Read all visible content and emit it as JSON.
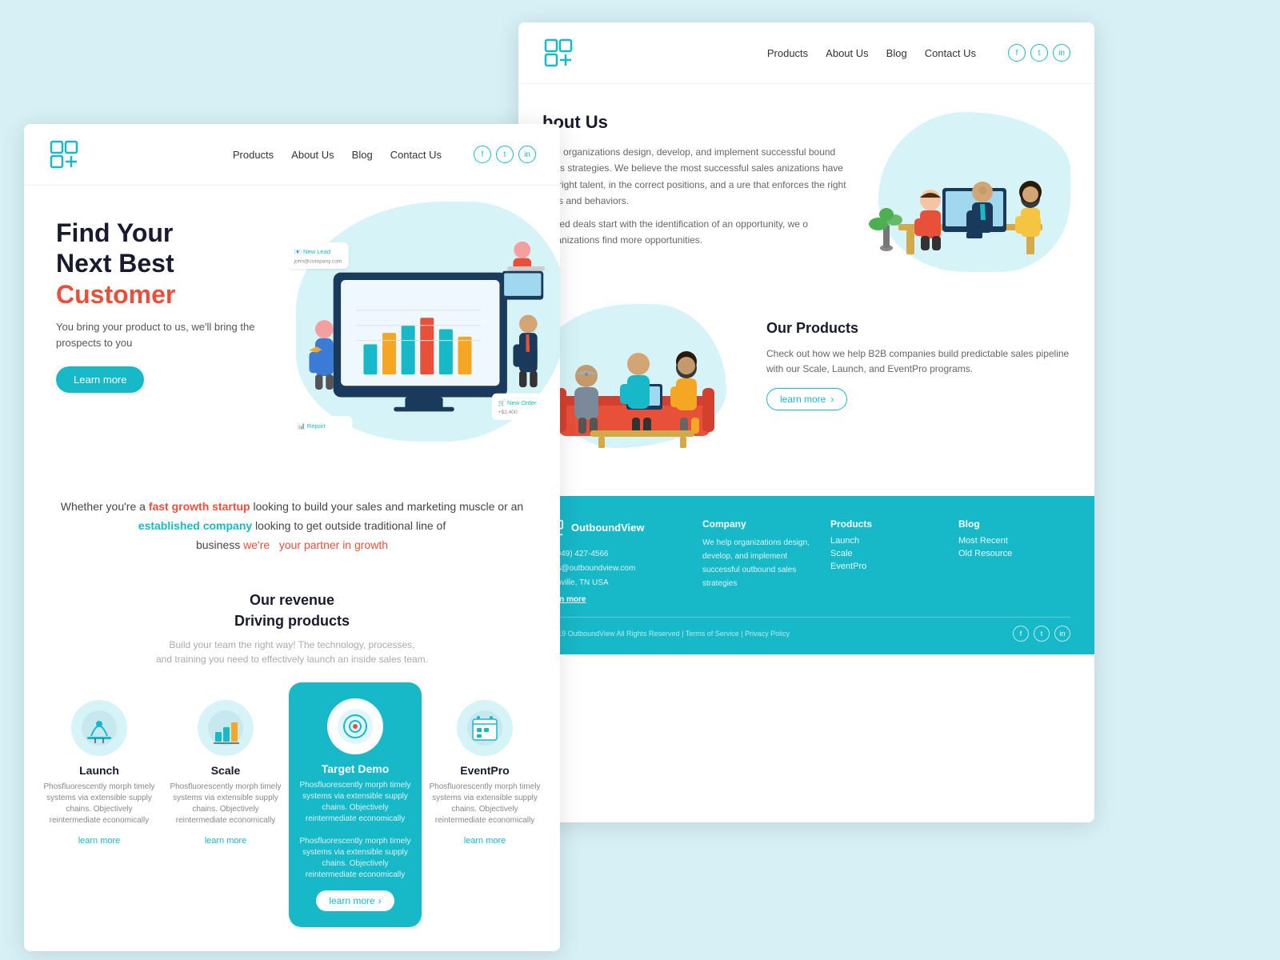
{
  "background_color": "#d6f0f5",
  "left_page": {
    "nav": {
      "links": [
        "Products",
        "About Us",
        "Blog",
        "Contact Us"
      ]
    },
    "hero": {
      "title_line1": "Find Your",
      "title_line2": "Next Best",
      "title_highlight": "Customer",
      "subtitle": "You bring your product to us, we'll bring the prospects to you",
      "cta_label": "Learn more"
    },
    "mid_text": {
      "line1_pre": "Whether you're a ",
      "line1_orange": "fast growth startup",
      "line1_post": " looking to build your sales and marketing muscle or an",
      "line2_pre": "",
      "line2_blue": "established company",
      "line2_post": " looking to get outside traditional line of",
      "line3_pre": "business ",
      "line3_orange": "we're  your partner in growth"
    },
    "revenue": {
      "title_line1": "Our revenue",
      "title_line2": "Driving products",
      "subtitle": "Build your team the right way! The technology, processes,\nand training you need to effectively launch an inside sales team."
    },
    "products": [
      {
        "name": "Launch",
        "desc": "Phosfluorescently morph timely systems via extensible supply chains. Objectively reintermediate economically",
        "learn_label": "learn more",
        "active": false
      },
      {
        "name": "Scale",
        "desc": "Phosfluorescently morph timely systems via extensible supply chains. Objectively reintermediate economically",
        "learn_label": "learn more",
        "active": false
      },
      {
        "name": "Target Demo",
        "desc": "Phosfluorescently morph timely systems via extensible supply chains. Objectively reintermediate economically\n\nPhosfluorescently morph timely systems via extensible supply chains. Objectively reintermediate economically",
        "learn_label": "learn more",
        "active": true
      },
      {
        "name": "EventPro",
        "desc": "Phosfluorescently morph timely systems via extensible supply chains. Objectively reintermediate economically",
        "learn_label": "learn more",
        "active": false
      }
    ]
  },
  "right_page": {
    "nav": {
      "links": [
        "Products",
        "About Us",
        "Blog",
        "Contact Us"
      ]
    },
    "about": {
      "title": "bout Us",
      "paragraphs": [
        "help organizations design, develop, and implement successful bound sales strategies.  We believe the most successful sales anizations have the right talent, in the correct positions, and a ure that enforces the right skills and behaviors.",
        "closed deals start with the identification of an opportunity, we o organizations find more opportunities."
      ]
    },
    "our_products": {
      "title": "Our Products",
      "desc": "Check out how we help B2B companies build predictable sales pipeline with our Scale, Launch, and EventPro programs.",
      "learn_label": "learn more"
    },
    "footer": {
      "company_name": "OutboundView",
      "tagline": "We help organizations design, develop, and implement successful outbound sales strategies",
      "learn_link": "Learn more",
      "phone": "+1 (949) 427-4566",
      "email": "sales@outboundview.com",
      "location": "Nashville, TN\nUSA",
      "columns": [
        {
          "title": "Company",
          "links": []
        },
        {
          "title": "Products",
          "links": [
            "Launch",
            "Scale",
            "EventPro"
          ]
        },
        {
          "title": "Blog",
          "links": [
            "Most Recent",
            "Old Resource"
          ]
        }
      ],
      "copyright": "© 2019 OutboundView All Rights Reserved | Terms of Service | Privacy Policy"
    }
  }
}
